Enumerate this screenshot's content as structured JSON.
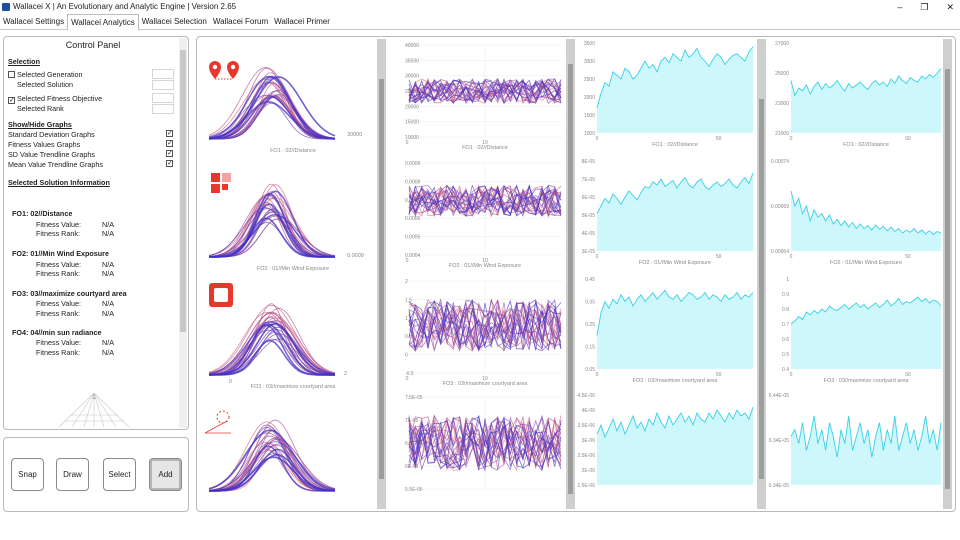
{
  "window": {
    "title": "Wallacei X  |  An Evolutionary and Analytic Engine  |  Version 2.65",
    "controls": {
      "minimize": "–",
      "maximize": "❐",
      "close": "✕"
    }
  },
  "tabs": [
    "Wallacei Settings",
    "Wallacei Analytics",
    "Wallacei Selection",
    "Wallacei Forum",
    "Wallacei Primer"
  ],
  "active_tab": 1,
  "control_panel": {
    "title": "Control Panel",
    "selection": {
      "heading": "Selection",
      "generation_label": "Selected Generation",
      "solution_label": "Selected Solution",
      "fitness_label": "Selected Fitness Objective",
      "rank_label": "Selected Rank",
      "fitness_checked": true
    },
    "graphs": {
      "heading": "Show/Hide Graphs",
      "items": [
        {
          "label": "Standard Deviation Graphs",
          "checked": true
        },
        {
          "label": "Fitness Values Graphs",
          "checked": true
        },
        {
          "label": "SD Value Trendline Graphs",
          "checked": true
        },
        {
          "label": "Mean Value Trendline Graphs",
          "checked": true
        }
      ]
    },
    "solution_info": {
      "heading": "Selected Solution Information",
      "objectives": [
        {
          "name": "FO1:  02//Distance",
          "value_label": "Fitness Value:",
          "value": "N/A",
          "rank_label": "Fitness Rank:",
          "rank": "N/A"
        },
        {
          "name": "FO2:  01//Min Wind Exposure",
          "value_label": "Fitness Value:",
          "value": "N/A",
          "rank_label": "Fitness Rank:",
          "rank": "N/A"
        },
        {
          "name": "FO3:  03//maximize courtyard area",
          "value_label": "Fitness Value:",
          "value": "N/A",
          "rank_label": "Fitness Rank:",
          "rank": "N/A"
        },
        {
          "name": "FO4:  04//min sun radiance",
          "value_label": "Fitness Value:",
          "value": "N/A",
          "rank_label": "Fitness Rank:",
          "rank": "N/A"
        }
      ]
    },
    "tree_label": "1"
  },
  "buttons": {
    "snap": "Snap",
    "draw": "Draw",
    "select": "Select",
    "add": "Add"
  },
  "chart_data": [
    {
      "type": "line",
      "description_kind": "standard deviation curves",
      "rows": [
        {
          "xlabel": "FO1 : 02//Distance",
          "tick_label": "30000"
        },
        {
          "xlabel": "FO2 : 01//Min Wind Exposure",
          "tick_label": "0.0009"
        },
        {
          "xlabel": "FO3 : 03//maximize courtyard area",
          "tick_left": "0",
          "tick_label": "2"
        },
        {
          "xlabel": "",
          "tick_label": ""
        }
      ]
    },
    {
      "type": "line",
      "description_kind": "fitness values per generation",
      "rows": [
        {
          "xlabel": "FO1 : 02//Distance",
          "yticks": [
            "40000",
            "35000",
            "30000",
            "25000",
            "20000",
            "15000",
            "10000"
          ],
          "xticks": [
            "0",
            "10"
          ],
          "band": [
            21000,
            29000
          ]
        },
        {
          "xlabel": "FO2 : 01//Min Wind Exposure",
          "yticks": [
            "0.0009",
            "0.0008",
            "0.0007",
            "0.0006",
            "0.0005",
            "0.0004"
          ],
          "xticks": [
            "0",
            "10"
          ],
          "band": [
            0.00061,
            0.00078
          ]
        },
        {
          "xlabel": "FO3 : 03//maximize courtyard area",
          "yticks": [
            "2",
            "1.5",
            "1",
            "0.5",
            "0",
            "-0.5"
          ],
          "xticks": [
            "0",
            "10"
          ],
          "band": [
            0.1,
            1.5
          ]
        },
        {
          "xlabel": "",
          "yticks": [
            "7.5E-05",
            "7E-05",
            "6.5E-05",
            "6E-05",
            "5.5E-05"
          ],
          "xticks": [],
          "band": [
            5.9e-05,
            7.1e-05
          ]
        }
      ]
    },
    {
      "type": "area",
      "description_kind": "standard deviation trendline",
      "rows": [
        {
          "xlabel": "FO1 : 02//Distance",
          "yticks": [
            "3500",
            "3000",
            "2500",
            "2000",
            "1500",
            "1000"
          ],
          "xticks": [
            "0",
            "50"
          ],
          "ylim": [
            1000,
            3500
          ],
          "values": [
            1700,
            2100,
            2400,
            2300,
            2700,
            2600,
            2500,
            2800,
            2700,
            2500,
            2600,
            2800,
            3000,
            2800,
            2900,
            2700,
            3000,
            3100,
            2950,
            3200,
            3100,
            3000,
            3300,
            3100,
            3200,
            3350,
            3100,
            3000,
            2850,
            3050,
            3200,
            3100,
            2900,
            3050,
            3150,
            3200,
            3100,
            3000,
            3250,
            3400
          ]
        },
        {
          "xlabel": "FO2 : 01//Min Wind Exposure",
          "yticks": [
            "8E-05",
            "7E-05",
            "6E-05",
            "5E-05",
            "4E-05",
            "3E-05"
          ],
          "xticks": [
            "0",
            "50"
          ],
          "ylim": [
            3e-05,
            9e-05
          ],
          "values": [
            5.5e-05,
            6e-05,
            6.5e-05,
            6.2e-05,
            6.8e-05,
            6.5e-05,
            6.1e-05,
            6.6e-05,
            7e-05,
            6.7e-05,
            6.4e-05,
            6.9e-05,
            7.3e-05,
            7.2e-05,
            7.6e-05,
            7.4e-05,
            7.8e-05,
            7.3e-05,
            7.5e-05,
            7.7e-05,
            7.2e-05,
            7.6e-05,
            7.9e-05,
            7.4e-05,
            7.2e-05,
            7.6e-05,
            7.8e-05,
            7.3e-05,
            7.1e-05,
            7.4e-05,
            7.6e-05,
            7.3e-05,
            7.5e-05,
            7.8e-05,
            7.4e-05,
            7.2e-05,
            7.6e-05,
            7.9e-05,
            7.5e-05,
            8.2e-05
          ]
        },
        {
          "xlabel": "FO3 : 03//maximize courtyard area",
          "yticks": [
            "0.45",
            "0.35",
            "0.25",
            "0.15",
            "0.05"
          ],
          "xticks": [
            "0",
            "50"
          ],
          "ylim": [
            0.05,
            0.45
          ],
          "values": [
            0.2,
            0.3,
            0.35,
            0.32,
            0.36,
            0.34,
            0.38,
            0.35,
            0.37,
            0.33,
            0.36,
            0.38,
            0.35,
            0.37,
            0.39,
            0.36,
            0.38,
            0.4,
            0.37,
            0.36,
            0.38,
            0.35,
            0.37,
            0.39,
            0.38,
            0.36,
            0.37,
            0.39,
            0.36,
            0.38,
            0.37,
            0.35,
            0.38,
            0.36,
            0.37,
            0.39,
            0.36,
            0.38,
            0.37,
            0.39
          ]
        },
        {
          "xlabel": "",
          "yticks": [
            "4.5E-06",
            "4E-06",
            "3.5E-06",
            "3E-06",
            "2.5E-06",
            "2E-06",
            "1.5E-06"
          ],
          "xticks": [],
          "ylim": [
            1.5e-06,
            4.5e-06
          ],
          "values": [
            3.2e-06,
            3.5e-06,
            3.1e-06,
            3.4e-06,
            3.7e-06,
            3.3e-06,
            3.6e-06,
            3.2e-06,
            3.5e-06,
            3.8e-06,
            3.4e-06,
            3.6e-06,
            3.3e-06,
            3.7e-06,
            3.5e-06,
            3.9e-06,
            3.6e-06,
            3.4e-06,
            3.8e-06,
            3.5e-06,
            3.7e-06,
            3.9e-06,
            3.6e-06,
            3.8e-06,
            3.5e-06,
            3.9e-06,
            3.7e-06,
            3.6e-06,
            3.9e-06,
            3.7e-06,
            4e-06,
            3.8e-06,
            3.6e-06,
            3.9e-06,
            3.7e-06,
            4e-06,
            3.8e-06,
            3.9e-06,
            3.7e-06,
            4.1e-06
          ]
        }
      ]
    },
    {
      "type": "area",
      "description_kind": "mean value trendline",
      "rows": [
        {
          "xlabel": "FO1 : 02//Distance",
          "yticks": [
            "27000",
            "25000",
            "23000",
            "21000"
          ],
          "xticks": [
            "0",
            "50"
          ],
          "ylim": [
            21000,
            27000
          ],
          "values": [
            24500,
            23500,
            24000,
            23800,
            24200,
            23600,
            24100,
            24400,
            23900,
            24300,
            24000,
            24200,
            24500,
            24100,
            23800,
            24300,
            24000,
            24200,
            24400,
            24100,
            23900,
            24300,
            24500,
            24200,
            24400,
            24100,
            24600,
            24300,
            24800,
            24500,
            24300,
            24700,
            24500,
            24400,
            24800,
            24600,
            24900,
            24700,
            25000,
            25300
          ]
        },
        {
          "xlabel": "FO2 : 01//Min Wind Exposure",
          "yticks": [
            "0.00074",
            "0.00069",
            "0.00064"
          ],
          "xticks": [
            "0",
            "50"
          ],
          "ylim": [
            0.00064,
            0.00076
          ],
          "values": [
            0.00072,
            0.0007,
            0.00071,
            0.00069,
            0.0007,
            0.00068,
            0.000695,
            0.000685,
            0.00069,
            0.00068,
            0.000688,
            0.000676,
            0.000682,
            0.000674,
            0.00068,
            0.000672,
            0.000678,
            0.00067,
            0.000676,
            0.00067,
            0.000674,
            0.000668,
            0.000675,
            0.000669,
            0.000673,
            0.000667,
            0.000672,
            0.000666,
            0.00067,
            0.000664,
            0.000668,
            0.000665,
            0.00067,
            0.000664,
            0.000668,
            0.000663,
            0.000667,
            0.000662,
            0.000666,
            0.000664
          ]
        },
        {
          "xlabel": "FO3 : 03//maximize courtyard area",
          "yticks": [
            "1",
            "0.9",
            "0.8",
            "0.7",
            "0.6",
            "0.5",
            "0.4"
          ],
          "xticks": [
            "0",
            "50"
          ],
          "ylim": [
            0.4,
            1.0
          ],
          "values": [
            0.7,
            0.72,
            0.75,
            0.73,
            0.78,
            0.76,
            0.79,
            0.77,
            0.8,
            0.78,
            0.82,
            0.8,
            0.79,
            0.81,
            0.83,
            0.8,
            0.82,
            0.84,
            0.81,
            0.83,
            0.8,
            0.82,
            0.84,
            0.81,
            0.83,
            0.86,
            0.82,
            0.84,
            0.87,
            0.83,
            0.85,
            0.84,
            0.86,
            0.88,
            0.85,
            0.87,
            0.84,
            0.86,
            0.85,
            0.82
          ]
        },
        {
          "xlabel": "",
          "yticks": [
            "6.44E-05",
            "6.34E-05",
            "6.34E-05"
          ],
          "xticks": [],
          "ylim": [
            6.33e-05,
            6.46e-05
          ],
          "values": [
            6.4e-05,
            6.41e-05,
            6.39e-05,
            6.42e-05,
            6.38e-05,
            6.4e-05,
            6.43e-05,
            6.39e-05,
            6.41e-05,
            6.38e-05,
            6.42e-05,
            6.4e-05,
            6.37e-05,
            6.41e-05,
            6.39e-05,
            6.43e-05,
            6.38e-05,
            6.4e-05,
            6.42e-05,
            6.39e-05,
            6.41e-05,
            6.37e-05,
            6.4e-05,
            6.42e-05,
            6.38e-05,
            6.41e-05,
            6.39e-05,
            6.43e-05,
            6.38e-05,
            6.4e-05,
            6.42e-05,
            6.39e-05,
            6.41e-05,
            6.38e-05,
            6.4e-05,
            6.43e-05,
            6.39e-05,
            6.41e-05,
            6.38e-05,
            6.42e-05
          ]
        }
      ]
    }
  ],
  "colors": {
    "area_fill": "#cdf7fb",
    "area_line": "#37d0e8",
    "curve_warm": "#e86a7c",
    "curve_cool": "#3b2fc9",
    "icon_red": "#e8382b"
  }
}
